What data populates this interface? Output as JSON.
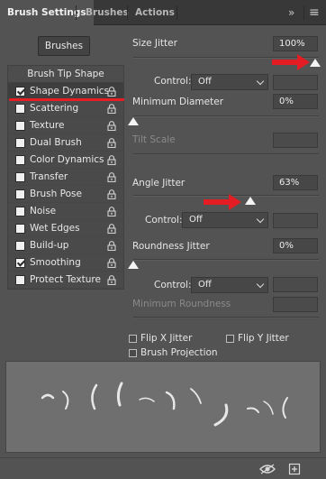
{
  "tabs": [
    {
      "label": "Brush Settings",
      "active": true
    },
    {
      "label": "Brushes",
      "active": false
    },
    {
      "label": "Actions",
      "active": false
    }
  ],
  "tabbar_icons": {
    "collapse": "double-chevron-right-icon",
    "menu": "hamburger-menu-icon",
    "collapse_glyph": "»",
    "menu_glyph": "≡"
  },
  "brushes_button_label": "Brushes",
  "brush_tip_shape_label": "Brush Tip Shape",
  "options": [
    {
      "label": "Shape Dynamics",
      "checked": true,
      "selected": true
    },
    {
      "label": "Scattering",
      "checked": false
    },
    {
      "label": "Texture",
      "checked": false
    },
    {
      "label": "Dual Brush",
      "checked": false
    },
    {
      "label": "Color Dynamics",
      "checked": false
    },
    {
      "label": "Transfer",
      "checked": false
    },
    {
      "label": "Brush Pose",
      "checked": false
    },
    {
      "label": "Noise",
      "checked": false
    },
    {
      "label": "Wet Edges",
      "checked": false
    },
    {
      "label": "Build-up",
      "checked": false
    },
    {
      "label": "Smoothing",
      "checked": true
    },
    {
      "label": "Protect Texture",
      "checked": false
    }
  ],
  "size_jitter": {
    "label": "Size Jitter",
    "value": "100%",
    "level": 1.0
  },
  "size_control": {
    "label": "Control:",
    "value": "Off"
  },
  "minimum_diameter": {
    "label": "Minimum Diameter",
    "value": "0%",
    "level": 0.0
  },
  "tilt_scale": {
    "label": "Tilt Scale",
    "value": ""
  },
  "angle_jitter": {
    "label": "Angle Jitter",
    "value": "63%",
    "level": 0.63
  },
  "angle_control": {
    "label": "Control:",
    "value": "Off"
  },
  "roundness_jitter": {
    "label": "Roundness Jitter",
    "value": "0%",
    "level": 0.0
  },
  "roundness_control": {
    "label": "Control:",
    "value": "Off"
  },
  "minimum_roundness": {
    "label": "Minimum Roundness",
    "value": ""
  },
  "flip_x": {
    "label": "Flip X Jitter",
    "checked": false
  },
  "flip_y": {
    "label": "Flip Y Jitter",
    "checked": false
  },
  "brush_projection": {
    "label": "Brush Projection",
    "checked": false
  },
  "bottom_icons": [
    "eye-toggle-icon",
    "new-preset-icon"
  ],
  "colors": {
    "panel": "#535353",
    "tab_bar": "#383838",
    "annotation_red": "#e81e25",
    "preview_bg": "#6f6f6f"
  }
}
